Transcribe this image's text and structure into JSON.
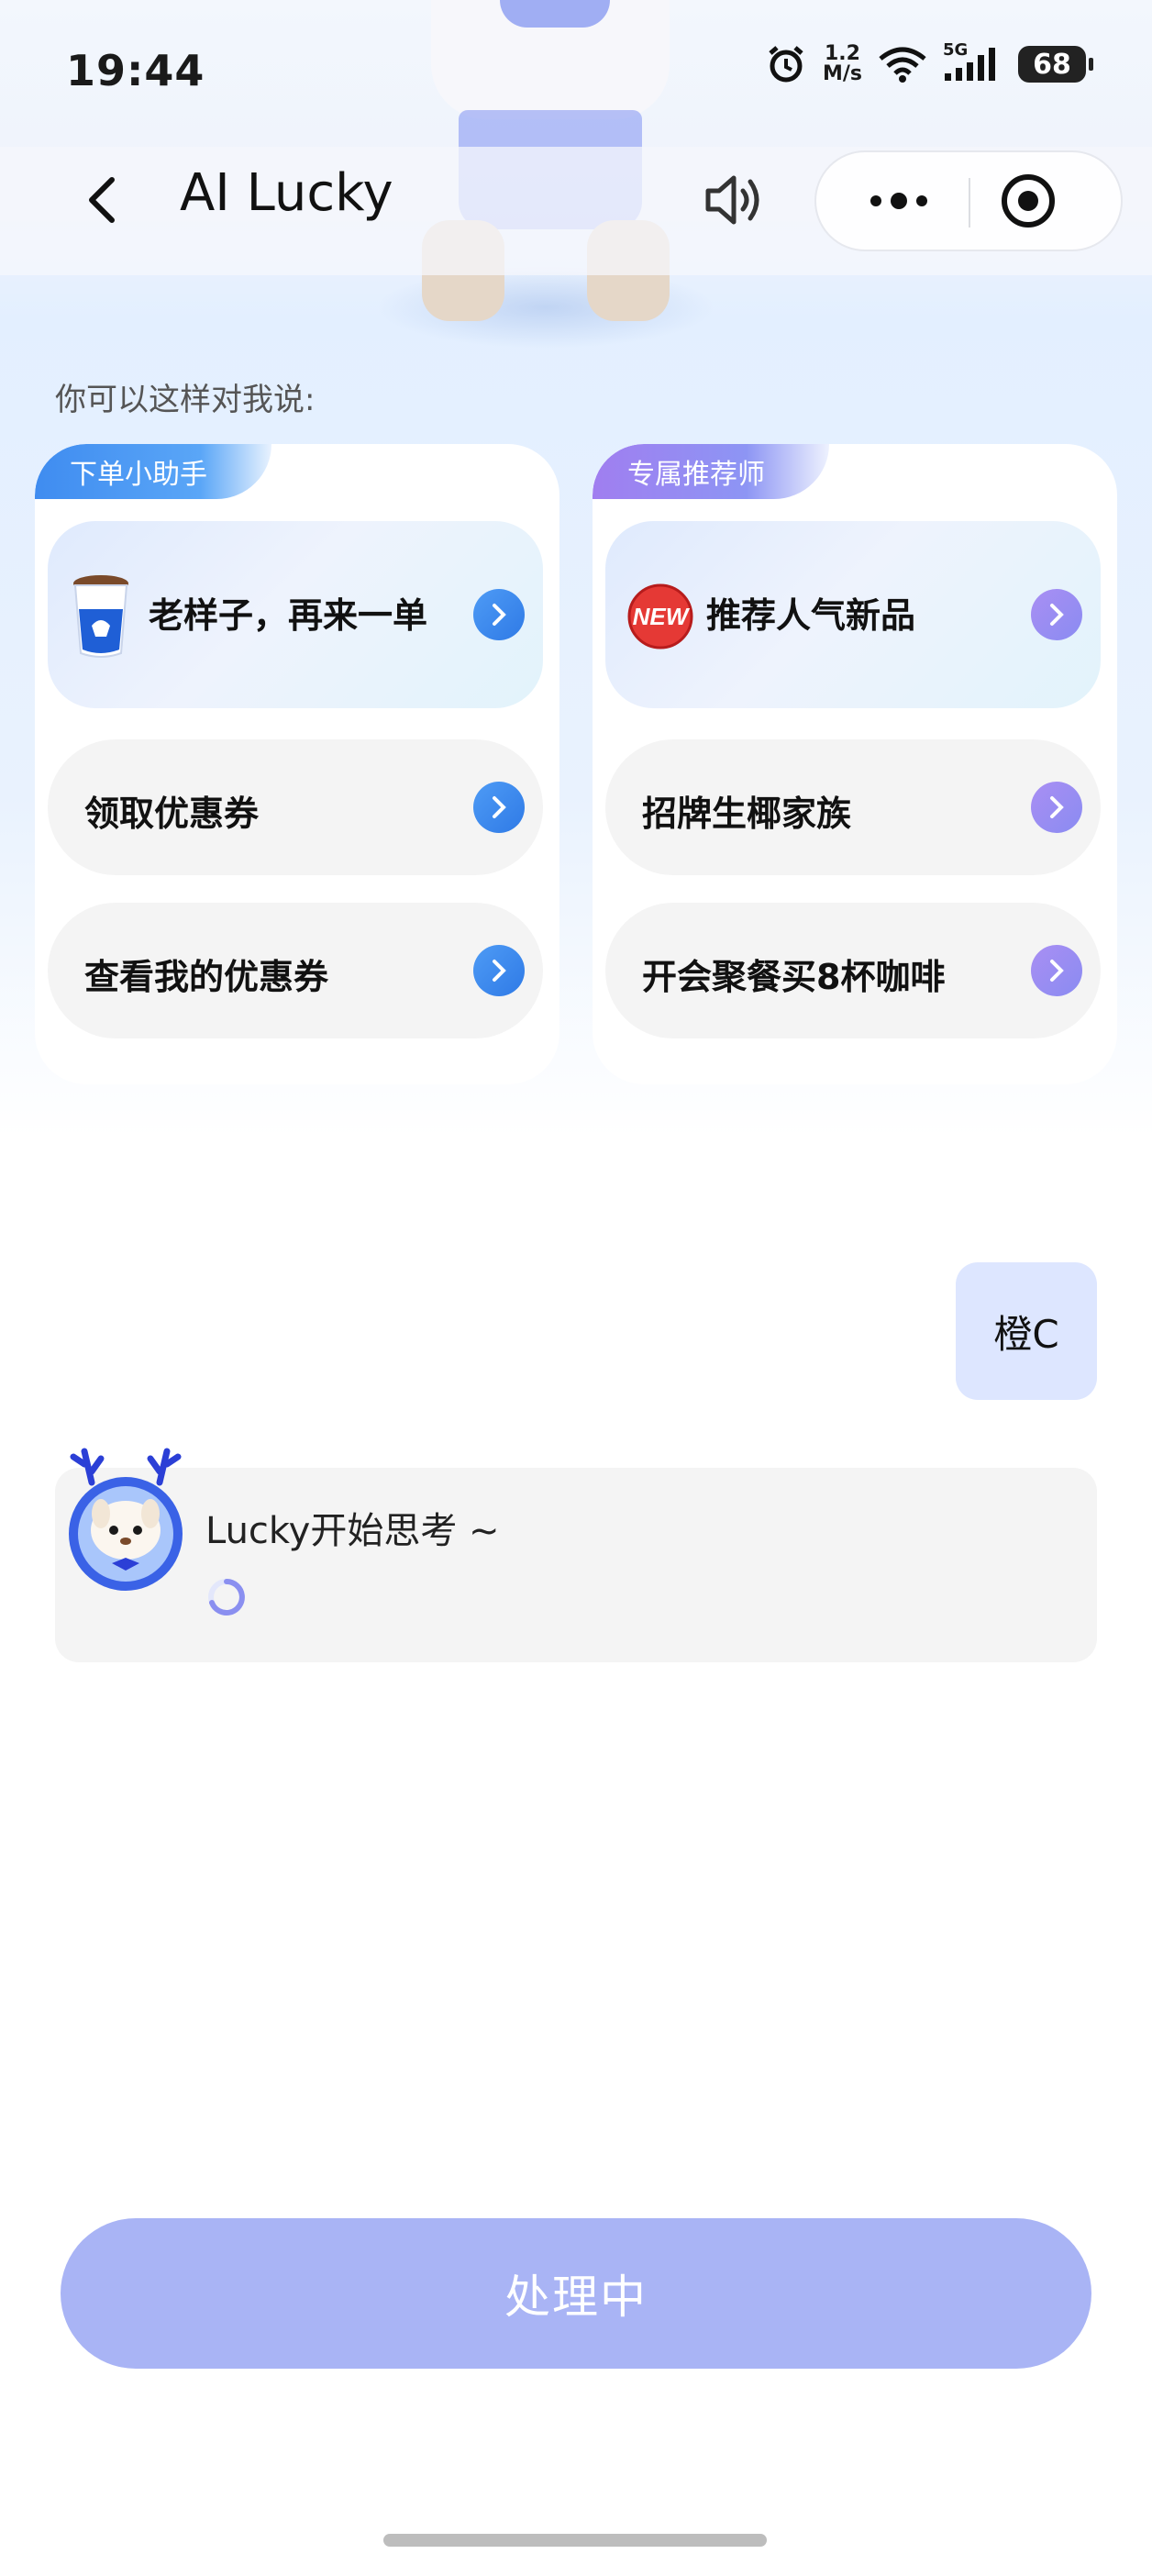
{
  "status_bar": {
    "time": "19:44",
    "net_speed_value": "1.2",
    "net_speed_unit": "M/s",
    "network_type": "5G",
    "battery": "68"
  },
  "nav": {
    "title": "AI Lucky"
  },
  "hint": "你可以这样对我说:",
  "cards": [
    {
      "tag": "下单小助手",
      "featured": "老样子，再来一单",
      "options": [
        "领取优惠券",
        "查看我的优惠券"
      ],
      "accent": "#3f8cf0"
    },
    {
      "tag": "专属推荐师",
      "featured": "推荐人气新品",
      "options": [
        "招牌生椰家族",
        "开会聚餐买8杯咖啡"
      ],
      "accent": "#9a84f2"
    }
  ],
  "chat": {
    "user_message": "橙C",
    "bot_status": "Lucky开始思考 ~"
  },
  "action_button": "处理中",
  "colors": {
    "user_bubble": "#dde6ff",
    "action_button": "#a9b4f5"
  },
  "icons": {
    "featured_left": "coffee-cup-icon",
    "featured_right": "new-badge-icon",
    "option_arrow": "chevron-right-icon"
  }
}
